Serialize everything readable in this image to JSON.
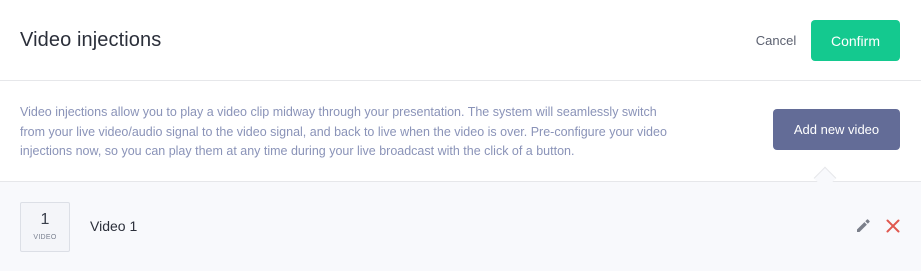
{
  "header": {
    "title": "Video injections",
    "cancel_label": "Cancel",
    "confirm_label": "Confirm"
  },
  "info": {
    "description": "Video injections allow you to play a video clip midway through your presentation. The system will seamlessly switch from your live video/audio signal to the video signal, and back to live when the video is over. Pre-configure your video injections now, so you can play them at any time during your live broadcast with the click of a button.",
    "add_button_label": "Add new video"
  },
  "videos": [
    {
      "number": "1",
      "caption": "VIDEO",
      "name": "Video 1"
    }
  ],
  "icons": {
    "edit": "pencil-icon",
    "delete": "close-icon"
  },
  "colors": {
    "confirm": "#14c98f",
    "add_button": "#636c97",
    "delete_icon": "#e0584f",
    "info_text": "#8a93b8"
  }
}
